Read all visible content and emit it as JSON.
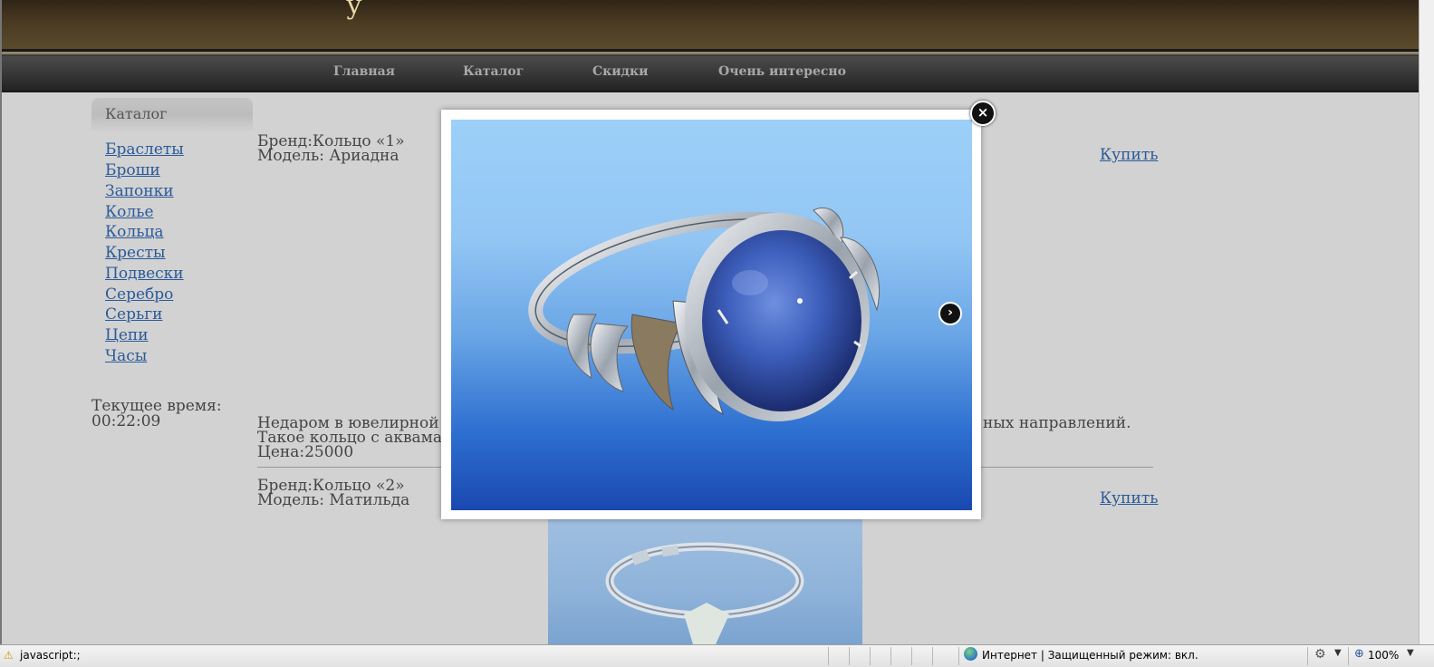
{
  "header": {
    "brand_fragment": "у"
  },
  "nav": {
    "items": [
      {
        "label": "Главная"
      },
      {
        "label": "Каталог"
      },
      {
        "label": "Скидки"
      },
      {
        "label": "Очень интересно"
      }
    ]
  },
  "sidebar": {
    "title": "Каталог",
    "categories": [
      "Браслеты",
      "Броши",
      "Запонки",
      "Колье",
      "Кольца",
      "Кресты",
      "Подвески",
      "Серебро",
      "Серьги",
      "Цепи",
      "Часы"
    ],
    "clock": {
      "label": "Текущее время:",
      "value": "00:22:09"
    }
  },
  "products": [
    {
      "brand": "Бренд:Кольцо «1»",
      "model": "Модель: Ариадна",
      "buy_label": "Купить",
      "description_line1_left": "Недаром в ювелирной ко",
      "description_line1_right": "ных направлений.",
      "description_line2_left": "Такое кольцо с аквамари",
      "price": "Цена:25000"
    },
    {
      "brand": "Бренд:Кольцо «2»",
      "model": "Модель: Матильда",
      "buy_label": "Купить"
    }
  ],
  "lightbox": {
    "close_icon": "close-icon",
    "next_icon": "chevron-right-icon"
  },
  "statusbar": {
    "status_text": "javascript:;",
    "zone_text": "Интернет | Защищенный режим: вкл.",
    "zoom": "100%"
  }
}
